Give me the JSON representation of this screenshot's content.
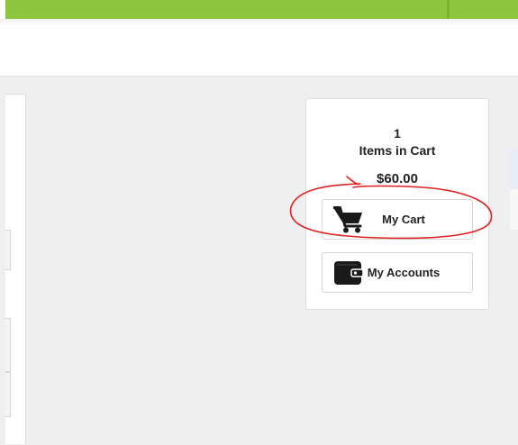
{
  "cart": {
    "count": "1",
    "items_label": "Items in Cart",
    "total": "$60.00"
  },
  "buttons": {
    "my_cart": "My Cart",
    "my_accounts": "My Accounts"
  },
  "icons": {
    "cart": "shopping-cart-icon",
    "wallet": "wallet-icon"
  },
  "colors": {
    "top_bar": "#8dc63f",
    "annotation": "#e02020",
    "background": "#efefef"
  }
}
